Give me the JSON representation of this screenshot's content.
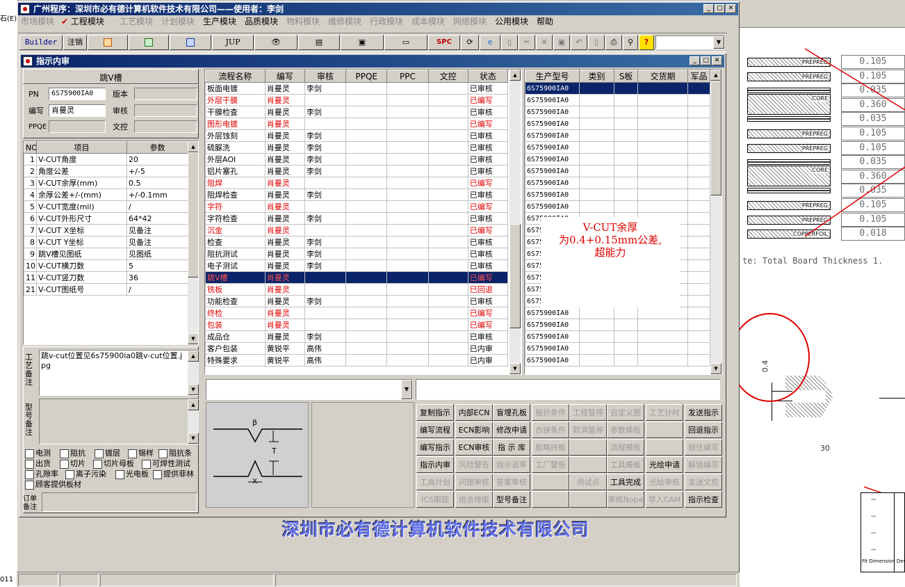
{
  "window": {
    "title": "广州程序：深圳市必有德计算机软件技术有限公司——使用者：李剑"
  },
  "menu": [
    {
      "label": "市场模块",
      "enabled": false
    },
    {
      "label": "工程模块",
      "enabled": true,
      "checked": true
    },
    {
      "label": "工艺模块",
      "enabled": false
    },
    {
      "label": "计划模块",
      "enabled": false
    },
    {
      "label": "生产模块",
      "enabled": true
    },
    {
      "label": "品质模块",
      "enabled": true
    },
    {
      "label": "物料模块",
      "enabled": false
    },
    {
      "label": "维修模块",
      "enabled": false
    },
    {
      "label": "行政模块",
      "enabled": false
    },
    {
      "label": "成本模块",
      "enabled": false
    },
    {
      "label": "网络模块",
      "enabled": false
    },
    {
      "label": "公用模块",
      "enabled": true
    },
    {
      "label": "帮助",
      "enabled": true
    }
  ],
  "toolbar": {
    "builder": "Builder",
    "logout": "注销",
    "jup": "JUP",
    "spc": "SPC"
  },
  "child": {
    "title": "指示内审"
  },
  "left": {
    "heading": "跳V槽",
    "pn_label": "PN",
    "pn": "6S75900IA0",
    "version_label": "版本",
    "version": "",
    "author_label": "编写",
    "author": "肖曼灵",
    "review_label": "审核",
    "review": "",
    "ppqe_label": "PPQE",
    "ppqe": "",
    "docctl_label": "文控",
    "docctl": "",
    "param_cols": [
      "NO",
      "项目",
      "参数"
    ],
    "params": [
      [
        "1",
        "V-CUT角度",
        "20"
      ],
      [
        "2",
        "角度公差",
        "+/-5"
      ],
      [
        "3",
        "V-CUT余厚(mm)",
        "0.5"
      ],
      [
        "4",
        "余厚公差+/-(mm)",
        "+/-0.1mm"
      ],
      [
        "5",
        "V-CUT宽度(mil)",
        "/"
      ],
      [
        "6",
        "V-CUT外形尺寸",
        "64*42"
      ],
      [
        "7",
        "V-CUT X坐标",
        "见备注"
      ],
      [
        "8",
        "V-CUT Y坐标",
        "见备注"
      ],
      [
        "9",
        "跳V槽见图纸",
        "见图纸"
      ],
      [
        "10",
        "V-CUT横刀数",
        "5"
      ],
      [
        "11",
        "V-CUT竖刀数",
        "36"
      ],
      [
        "21",
        "V-CUT图纸号",
        "/"
      ]
    ],
    "craft_note_label": "工艺备注",
    "craft_note": "跳v-cut位置见6s75900ia0跳v-cut位置.jpg",
    "model_note_label": "型号备注",
    "model_note": "",
    "checks": [
      "电测",
      "阻抗",
      "镀层",
      "锡样",
      "阻抗条",
      "出货",
      "切片",
      "切片母板",
      "可焊性测试",
      "孔隙率",
      "离子污染",
      "光电板",
      "提供菲林",
      "顾客提供板材"
    ],
    "order_note_label": "订单备注"
  },
  "flow": {
    "cols": [
      "流程名称",
      "编写",
      "审核",
      "PPQE",
      "PPC",
      "文控",
      "状态"
    ],
    "rows": [
      {
        "name": "板面电镀",
        "author": "肖曼灵",
        "review": "李剑",
        "status": "已审核",
        "red": false
      },
      {
        "name": "外层干膜",
        "author": "肖曼灵",
        "review": "",
        "status": "已编写",
        "red": true
      },
      {
        "name": "干膜检查",
        "author": "肖曼灵",
        "review": "李剑",
        "status": "已审核",
        "red": false
      },
      {
        "name": "图形电镀",
        "author": "肖曼灵",
        "review": "",
        "status": "已编写",
        "red": true
      },
      {
        "name": "外层蚀刻",
        "author": "肖曼灵",
        "review": "李剑",
        "status": "已审核",
        "red": false
      },
      {
        "name": "硫脲洗",
        "author": "肖曼灵",
        "review": "李剑",
        "status": "已审核",
        "red": false
      },
      {
        "name": "外层AOI",
        "author": "肖曼灵",
        "review": "李剑",
        "status": "已审核",
        "red": false
      },
      {
        "name": "铝片塞孔",
        "author": "肖曼灵",
        "review": "李剑",
        "status": "已审核",
        "red": false
      },
      {
        "name": "阻焊",
        "author": "肖曼灵",
        "review": "",
        "status": "已编写",
        "red": true
      },
      {
        "name": "阻焊检查",
        "author": "肖曼灵",
        "review": "李剑",
        "status": "已审核",
        "red": false
      },
      {
        "name": "字符",
        "author": "肖曼灵",
        "review": "",
        "status": "已编写",
        "red": true
      },
      {
        "name": "字符检查",
        "author": "肖曼灵",
        "review": "李剑",
        "status": "已审核",
        "red": false
      },
      {
        "name": "沉金",
        "author": "肖曼灵",
        "review": "",
        "status": "已编写",
        "red": true
      },
      {
        "name": "检查",
        "author": "肖曼灵",
        "review": "李剑",
        "status": "已审核",
        "red": false
      },
      {
        "name": "阻抗测试",
        "author": "肖曼灵",
        "review": "李剑",
        "status": "已审核",
        "red": false
      },
      {
        "name": "电子测试",
        "author": "肖曼灵",
        "review": "李剑",
        "status": "已审核",
        "red": false
      },
      {
        "name": "跳V槽",
        "author": "肖曼灵",
        "review": "",
        "status": "已编写",
        "red": true,
        "selected": true
      },
      {
        "name": "铣板",
        "author": "肖曼灵",
        "review": "",
        "status": "已回退",
        "red": true
      },
      {
        "name": "功能检查",
        "author": "肖曼灵",
        "review": "李剑",
        "status": "已审核",
        "red": false
      },
      {
        "name": "终检",
        "author": "肖曼灵",
        "review": "",
        "status": "已编写",
        "red": true
      },
      {
        "name": "包装",
        "author": "肖曼灵",
        "review": "",
        "status": "已编写",
        "red": true
      },
      {
        "name": "成品仓",
        "author": "肖曼灵",
        "review": "李剑",
        "status": "已审核",
        "red": false
      },
      {
        "name": "客户包装",
        "author": "黄锐平",
        "review": "高伟",
        "status": "已内审",
        "red": false
      },
      {
        "name": "特殊要求",
        "author": "黄锐平",
        "review": "高伟",
        "status": "已内审",
        "red": false
      }
    ]
  },
  "models": {
    "cols": [
      "生产型号",
      "类别",
      "S板",
      "交货期",
      "军品"
    ],
    "rows": [
      "6S75900IA0",
      "6S75900IA0",
      "6S75900IA0",
      "6S75900IA0",
      "6S75900IA0",
      "6S75900IA0",
      "6S75900IA0",
      "6S75900IA0",
      "6S75900IA0",
      "6S75900IA0",
      "6S75900IA0",
      "6S75900IA0",
      "6S75900IA0",
      "6S75900IA0",
      "6S75900IA0",
      "6S75900IA0",
      "6S75900IA0",
      "6S75900IA0",
      "6S75900IA0",
      "6S75900IA0",
      "6S75900IA0",
      "6S75900IA0",
      "6S75900IA0",
      "6S75900IA0"
    ]
  },
  "note_popup": [
    "V-CUT余厚",
    "为0.4+0.15mm公差,",
    "超能力"
  ],
  "actions": [
    [
      {
        "l": "复制指示",
        "e": true
      },
      {
        "l": "内部ECN",
        "e": true
      },
      {
        "l": "盲埋孔板",
        "e": true
      },
      {
        "l": "报价条件",
        "e": false
      },
      {
        "l": "工程暂停",
        "e": false
      },
      {
        "l": "自定义图",
        "e": false
      },
      {
        "l": "工艺计时",
        "e": false
      },
      {
        "l": "发送指示",
        "e": true
      }
    ],
    [
      {
        "l": "编写流程",
        "e": true
      },
      {
        "l": "ECN影响",
        "e": true
      },
      {
        "l": "修改申请",
        "e": true
      },
      {
        "l": "合拼条件",
        "e": false
      },
      {
        "l": "取消暂停",
        "e": false
      },
      {
        "l": "参数模板",
        "e": false
      },
      {
        "l": "",
        "e": false
      },
      {
        "l": "回退指示",
        "e": true
      }
    ],
    [
      {
        "l": "编写指示",
        "e": true
      },
      {
        "l": "ECN审核",
        "e": true
      },
      {
        "l": "指 示 库",
        "e": true
      },
      {
        "l": "粗略拼板",
        "e": false
      },
      {
        "l": "",
        "e": false
      },
      {
        "l": "流程模板",
        "e": false
      },
      {
        "l": "",
        "e": false
      },
      {
        "l": "锁住编写",
        "e": false
      }
    ],
    [
      {
        "l": "指示内审",
        "e": true
      },
      {
        "l": "风险警告",
        "e": false
      },
      {
        "l": "指示退率",
        "e": false
      },
      {
        "l": "工厂警告",
        "e": false
      },
      {
        "l": "",
        "e": false
      },
      {
        "l": "工具模板",
        "e": false
      },
      {
        "l": "光绘申请",
        "e": true
      },
      {
        "l": "解锁编写",
        "e": false
      }
    ],
    [
      {
        "l": "工具计划",
        "e": false
      },
      {
        "l": "问题审核",
        "e": false
      },
      {
        "l": "答案审核",
        "e": false
      },
      {
        "l": "",
        "e": false
      },
      {
        "l": "测试点",
        "e": false
      },
      {
        "l": "工具完成",
        "e": true
      },
      {
        "l": "光绘审核",
        "e": false
      },
      {
        "l": "发送文控",
        "e": false
      }
    ],
    [
      {
        "l": "ICS跟踪",
        "e": false
      },
      {
        "l": "组合排版",
        "e": false
      },
      {
        "l": "型号备注",
        "e": true
      },
      {
        "l": "",
        "e": false
      },
      {
        "l": "",
        "e": false
      },
      {
        "l": "审核Nope",
        "e": false
      },
      {
        "l": "导入CAM",
        "e": false
      },
      {
        "l": "指示检查",
        "e": true
      }
    ]
  ],
  "company_banner": "深圳市必有德计算机软件技术有限公司",
  "drawing": {
    "beta": "β",
    "t": "T",
    "x": "X"
  },
  "bg_stack": {
    "layers": [
      "PREPREG",
      "PREPREG",
      "",
      "CORE",
      "",
      "PREPREG",
      "PREPREG",
      "",
      "CORE",
      "",
      "PREPREG",
      "PREPREG",
      "COPPERFOIL"
    ],
    "values": [
      "0.105",
      "0.105",
      "0.035",
      "0.360",
      "0.035",
      "0.105",
      "0.105",
      "0.035",
      "0.360",
      "0.035",
      "0.105",
      "0.105",
      "0.018"
    ],
    "note": "te: Total Board Thickness 1.",
    "dim": "0.4",
    "angle": "30",
    "table_cells": [
      "--",
      "--",
      "--",
      "--"
    ],
    "footer_cell": "Fit Dimension Dev"
  },
  "left_edge": {
    "top": "石(E)",
    "bottom": "011"
  }
}
